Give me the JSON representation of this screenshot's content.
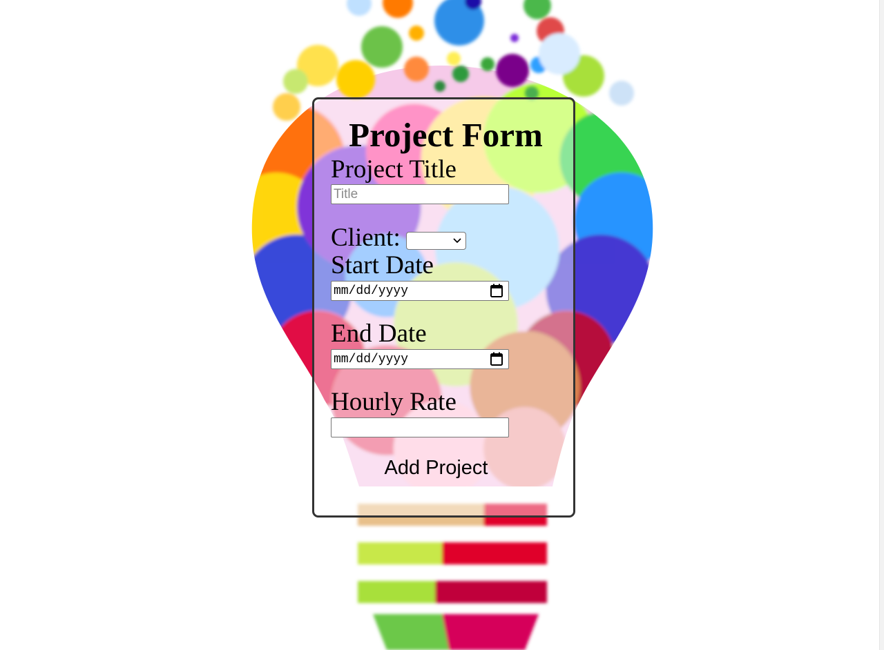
{
  "form": {
    "title": "Project Form",
    "project_title": {
      "label": "Project Title",
      "placeholder": "Title",
      "value": ""
    },
    "client": {
      "label": "Client:",
      "selected": ""
    },
    "start_date": {
      "label": "Start Date",
      "display": "mm/dd/yyyy"
    },
    "end_date": {
      "label": "End Date",
      "display": "mm/dd/yyyy"
    },
    "hourly_rate": {
      "label": "Hourly Rate",
      "value": ""
    },
    "submit_label": "Add Project"
  },
  "icons": {
    "date_picker": "calendar-icon",
    "dropdown": "chevron-down-icon"
  },
  "colors": {
    "card_border": "#333333",
    "text": "#000000",
    "input_border": "#767676",
    "placeholder": "#8a8a8a"
  }
}
